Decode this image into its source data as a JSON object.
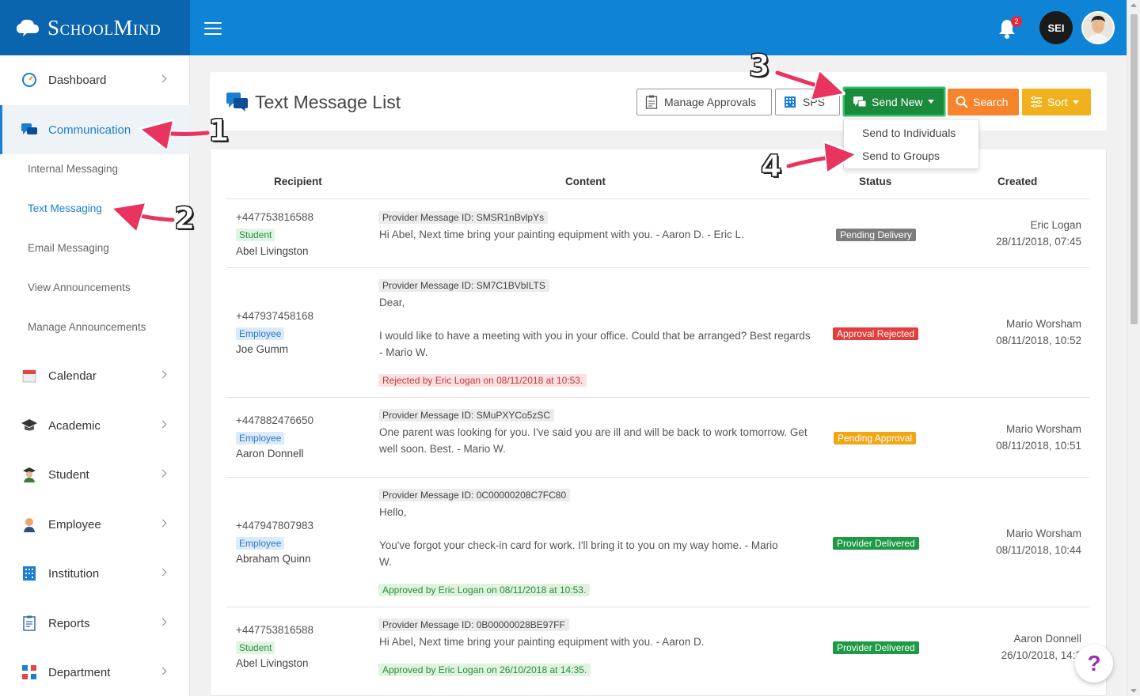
{
  "brand": {
    "name": "SchoolMind"
  },
  "header": {
    "notification_count": "2",
    "user_initials": "SEI"
  },
  "sidebar": {
    "items": [
      {
        "label": "Dashboard",
        "icon": "dashboard-icon"
      },
      {
        "label": "Communication",
        "icon": "chat-icon"
      },
      {
        "label": "Calendar",
        "icon": "calendar-icon"
      },
      {
        "label": "Academic",
        "icon": "graduation-cap-icon"
      },
      {
        "label": "Student",
        "icon": "student-icon"
      },
      {
        "label": "Employee",
        "icon": "employee-icon"
      },
      {
        "label": "Institution",
        "icon": "building-icon"
      },
      {
        "label": "Reports",
        "icon": "clipboard-icon"
      },
      {
        "label": "Department",
        "icon": "department-icon"
      }
    ],
    "sub_items": [
      {
        "label": "Internal Messaging"
      },
      {
        "label": "Text Messaging"
      },
      {
        "label": "Email Messaging"
      },
      {
        "label": "View Announcements"
      },
      {
        "label": "Manage Announcements"
      }
    ]
  },
  "page": {
    "title": "Text Message List",
    "buttons": {
      "manage_approvals": "Manage Approvals",
      "sps": "SPS",
      "send_new": "Send New",
      "search": "Search",
      "sort": "Sort"
    },
    "dropdown": [
      "Send to Individuals",
      "Send to Groups"
    ]
  },
  "table": {
    "columns": [
      "Recipient",
      "Content",
      "Status",
      "Created"
    ],
    "rows": [
      {
        "phone": "+447753816588",
        "role": "Student",
        "name": "Abel Livingston",
        "provider_id": "Provider Message ID: SMSR1nBvlpYs",
        "content": "Hi Abel, Next time bring your painting equipment with you. - Aaron D. - Eric L.",
        "note": "",
        "status": "Pending Delivery",
        "created_by": "Eric Logan",
        "created_at": "28/11/2018, 07:45"
      },
      {
        "phone": "+447937458168",
        "role": "Employee",
        "name": "Joe Gumm",
        "provider_id": "Provider Message ID: SM7C1BVbILTS",
        "content_line1": "Dear,",
        "content_line2": "I would like to have a meeting with you in your office. Could that be arranged? Best regards - Mario W.",
        "note": "Rejected by Eric Logan on 08/11/2018 at 10:53.",
        "status": "Approval Rejected",
        "created_by": "Mario Worsham",
        "created_at": "08/11/2018, 10:52"
      },
      {
        "phone": "+447882476650",
        "role": "Employee",
        "name": "Aaron Donnell",
        "provider_id": "Provider Message ID: SMuPXYCo5zSC",
        "content": "One parent was looking for you. I've said you are ill and will be back to work tomorrow. Get well soon. Best. - Mario W.",
        "note": "",
        "status": "Pending Approval",
        "created_by": "Mario Worsham",
        "created_at": "08/11/2018, 10:51"
      },
      {
        "phone": "+447947807983",
        "role": "Employee",
        "name": "Abraham Quinn",
        "provider_id": "Provider Message ID: 0C00000208C7FC80",
        "content_line1": "Hello,",
        "content_line2": "You've forgot your check-in card for work. I'll bring it to you on my way home. - Mario W.",
        "note": "Approved by Eric Logan on 08/11/2018 at 10:53.",
        "status": "Provider Delivered",
        "created_by": "Mario Worsham",
        "created_at": "08/11/2018, 10:44"
      },
      {
        "phone": "+447753816588",
        "role": "Student",
        "name": "Abel Livingston",
        "provider_id": "Provider Message ID: 0B00000028BE97FF",
        "content": "Hi Abel, Next time bring your painting equipment with you. - Aaron D.",
        "note": "Approved by Eric Logan on 26/10/2018 at 14:35.",
        "status": "Provider Delivered",
        "created_by": "Aaron Donnell",
        "created_at": "26/10/2018, 14:3"
      }
    ]
  },
  "annotations": [
    "1",
    "2",
    "3",
    "4"
  ],
  "help": {
    "label": "?"
  },
  "colors": {
    "primary": "#0f83d6",
    "brand_dark": "#0a64ae",
    "arrow": "#e8345f"
  }
}
